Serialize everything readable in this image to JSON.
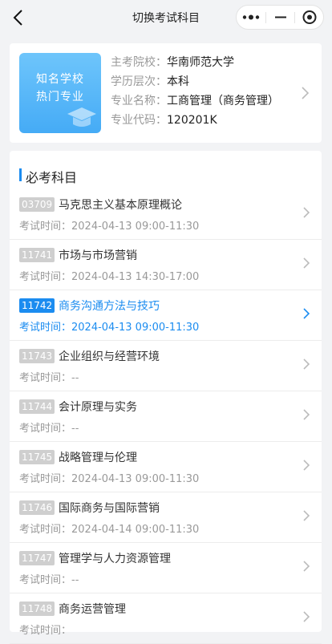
{
  "nav": {
    "title": "切换考试科目",
    "back_icon": "chevron-left-icon",
    "menu_icons": [
      "more-dots-icon",
      "minimize-icon",
      "close-target-icon"
    ]
  },
  "info": {
    "banner_line1": "知名学校",
    "banner_line2": "热门专业",
    "banner_icon": "graduation-cap-icon",
    "rows": [
      {
        "label": "主考院校：",
        "value": "华南师范大学"
      },
      {
        "label": "学历层次：",
        "value": "本科"
      },
      {
        "label": "专业名称：",
        "value": "工商管理（商务管理）"
      },
      {
        "label": "专业代码：",
        "value": "120201K"
      }
    ]
  },
  "subjects": {
    "title": "必考科目",
    "time_label": "考试时间：",
    "items": [
      {
        "code": "03709",
        "name": "马克思主义基本原理概论",
        "time": "2024-04-13 09:00-11:30",
        "active": false
      },
      {
        "code": "11741",
        "name": "市场与市场营销",
        "time": "2024-04-13 14:30-17:00",
        "active": false
      },
      {
        "code": "11742",
        "name": "商务沟通方法与技巧",
        "time": "2024-04-13 09:00-11:30",
        "active": true
      },
      {
        "code": "11743",
        "name": "企业组织与经营环境",
        "time": "--",
        "active": false
      },
      {
        "code": "11744",
        "name": "会计原理与实务",
        "time": "--",
        "active": false
      },
      {
        "code": "11745",
        "name": "战略管理与伦理",
        "time": "2024-04-13 09:00-11:30",
        "active": false
      },
      {
        "code": "11746",
        "name": "国际商务与国际营销",
        "time": "2024-04-14 09:00-11:30",
        "active": false
      },
      {
        "code": "11747",
        "name": "管理学与人力资源管理",
        "time": "--",
        "active": false
      },
      {
        "code": "11748",
        "name": "商务运营管理",
        "time": "",
        "active": false
      }
    ]
  },
  "colors": {
    "accent": "#1b8cf0",
    "code_bg": "#cfcfcf",
    "page_bg": "#f2f3f5"
  }
}
